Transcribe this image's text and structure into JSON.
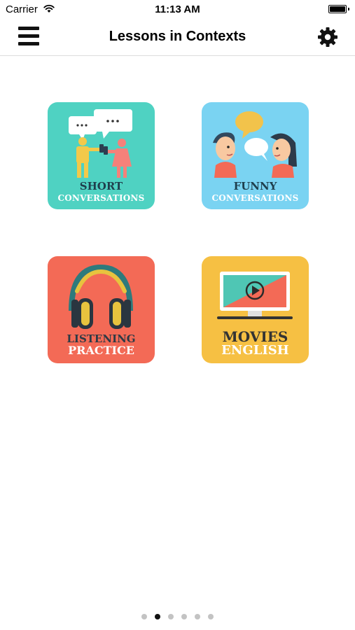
{
  "status_bar": {
    "carrier": "Carrier",
    "time": "11:13 AM",
    "wifi_icon": "wifi-icon",
    "battery_icon": "battery-icon"
  },
  "nav": {
    "title": "Lessons in Contexts",
    "menu_icon": "hamburger-menu-icon",
    "settings_icon": "gear-icon"
  },
  "tiles": [
    {
      "id": "short-conversations",
      "line1": "SHORT",
      "line2": "CONVERSATIONS",
      "color": "#4fd2c2",
      "icon": "chatting-people-icon"
    },
    {
      "id": "funny-conversations",
      "line1": "FUNNY",
      "line2": "CONVERSATIONS",
      "color": "#7ad3f2",
      "icon": "talking-faces-icon"
    },
    {
      "id": "listening-practice",
      "line1": "LISTENING",
      "line2": "PRACTICE",
      "color": "#f36a56",
      "icon": "headphones-icon"
    },
    {
      "id": "movies-english",
      "line1": "MOVIES",
      "line2": "ENGLISH",
      "color": "#f6c043",
      "icon": "monitor-play-icon"
    }
  ],
  "pager": {
    "count": 6,
    "active_index": 1
  }
}
